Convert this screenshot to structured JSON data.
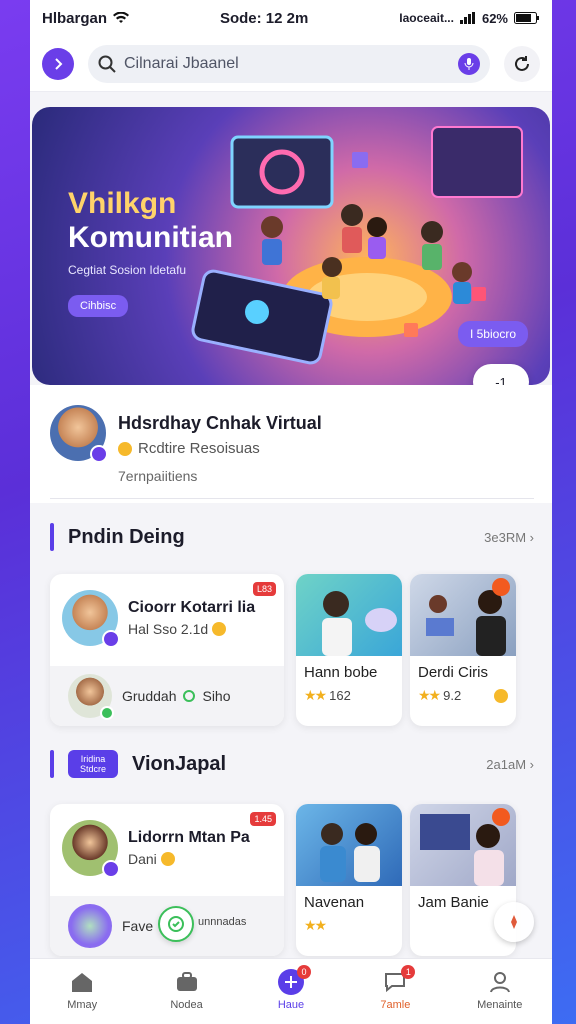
{
  "status_bar": {
    "carrier": "Hlbargan",
    "time": "Sode: 12 2m",
    "network": "Iaoceait...",
    "battery": "62%"
  },
  "search": {
    "placeholder": "Cilnarai Jbaanel"
  },
  "hero": {
    "title_line1": "Vhilkgn",
    "title_line2": "Komunitian",
    "subtitle": "Cegtiat Sosion Idetafu",
    "cta": "Cihbisc",
    "badge": "I 5biocro",
    "pager": "-1"
  },
  "profile": {
    "name": "Hdsrdhay Cnhak Virtual",
    "subtitle": "Rcdtire Resoisuas",
    "meta": "7ernpaiitiens"
  },
  "section1": {
    "title": "Pndin Deing",
    "more": "3e3RM",
    "big_card": {
      "tag": "L83",
      "name": "Cioorr Kotarri lia",
      "sub": "Hal Sso 2.1d",
      "bottom_text": "Gruddah",
      "bottom_extra": "Siho"
    },
    "small_cards": [
      {
        "name": "Hann bobe",
        "rating": "162"
      },
      {
        "name": "Derdi Ciris",
        "rating": "9.2"
      }
    ]
  },
  "section2": {
    "chip": "Iridina Stdcre",
    "title": "VionJapal",
    "more": "2a1aM",
    "big_card": {
      "tag": "1.45",
      "name": "Lidorrn Mtan Pa",
      "sub": "Dani",
      "bottom_text": "Fave",
      "bottom_extra": "unnnadas"
    },
    "small_cards": [
      {
        "name": "Navenan"
      },
      {
        "name": "Jam Banie"
      }
    ]
  },
  "bottom_nav": [
    {
      "label": "Mmay",
      "icon": "home-icon",
      "badge": ""
    },
    {
      "label": "Nodea",
      "icon": "briefcase-icon",
      "badge": ""
    },
    {
      "label": "Haue",
      "icon": "plus-icon",
      "badge": "0"
    },
    {
      "label": "7amle",
      "icon": "chat-icon",
      "badge": "1"
    },
    {
      "label": "Menainte",
      "icon": "profile-icon",
      "badge": ""
    }
  ],
  "colors": {
    "accent": "#6a3ee8",
    "danger": "#e53b3b",
    "success": "#3bbf5a",
    "star": "#f2b01e"
  }
}
